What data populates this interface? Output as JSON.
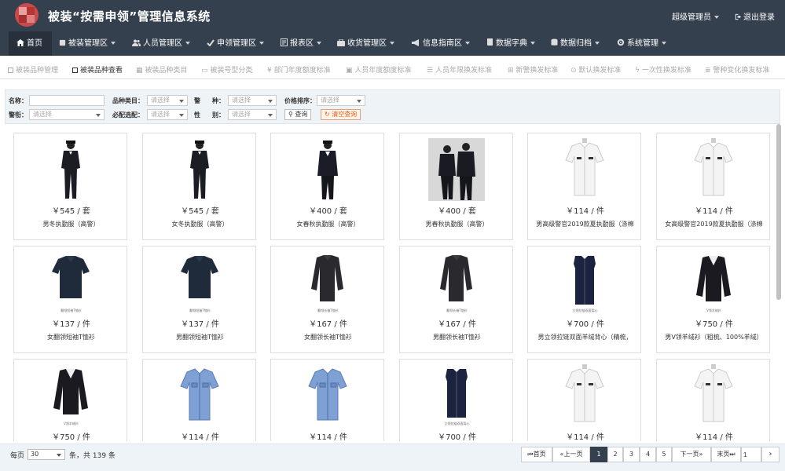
{
  "app": {
    "title": "被装“按需申领”管理信息系统"
  },
  "header": {
    "user": "超级管理员",
    "logout": "退出登录"
  },
  "nav": [
    {
      "label": "首页",
      "icon": "home-icon"
    },
    {
      "label": "被装管理区",
      "icon": "square-icon"
    },
    {
      "label": "人员管理区",
      "icon": "users-icon"
    },
    {
      "label": "申领管理区",
      "icon": "check-icon"
    },
    {
      "label": "报表区",
      "icon": "report-icon"
    },
    {
      "label": "收货管理区",
      "icon": "briefcase-icon"
    },
    {
      "label": "信息指南区",
      "icon": "megaphone-icon"
    },
    {
      "label": "数据字典",
      "icon": "book-icon"
    },
    {
      "label": "数据归档",
      "icon": "database-icon"
    },
    {
      "label": "系统管理",
      "icon": "gear-icon"
    }
  ],
  "subtabs": [
    {
      "label": "被装品种管理"
    },
    {
      "label": "被装品种查看"
    },
    {
      "label": "被装品种类目"
    },
    {
      "label": "被装号型分类"
    },
    {
      "label": "部门年度额度标准"
    },
    {
      "label": "人员年度额度标准"
    },
    {
      "label": "人员年限换发标准"
    },
    {
      "label": "新警换发标准"
    },
    {
      "label": "默认换发标准"
    },
    {
      "label": "一次性换发标准"
    },
    {
      "label": "警种变化换发标准"
    }
  ],
  "filters": {
    "name_label": "名称：",
    "name_value": "",
    "category_label": "品种类目：",
    "category_placeholder": "请选择",
    "police_type_label_a": "警",
    "police_type_label_b": "种：",
    "police_type_placeholder": "请选择",
    "price_sort_label": "价格排序：",
    "price_sort_placeholder": "请选择",
    "rank_label": "警衔：",
    "rank_placeholder": "请选择",
    "required_label": "必配选配：",
    "required_placeholder": "请选择",
    "gender_label_a": "性",
    "gender_label_b": "别：",
    "gender_placeholder": "请选择",
    "search_btn": "查询",
    "clear_btn": "清空查询"
  },
  "products": [
    {
      "price": "￥545 / 套",
      "name": "男冬执勤服（高警）",
      "kind": "winter"
    },
    {
      "price": "￥545 / 套",
      "name": "女冬执勤服（高警）",
      "kind": "winter"
    },
    {
      "price": "￥400 / 套",
      "name": "女春秋执勤服（高警）",
      "kind": "spring"
    },
    {
      "price": "￥400 / 套",
      "name": "男春秋执勤服（高警）",
      "kind": "pair"
    },
    {
      "price": "￥114 / 件",
      "name": "男高级警官2019款夏执勤服（涤棉",
      "kind": "whiteshirt"
    },
    {
      "price": "￥114 / 件",
      "name": "女高级警官2019款夏执勤服（涤棉",
      "kind": "whiteshirt"
    },
    {
      "price": "￥137 / 件",
      "name": "女翻领短袖T恤衫",
      "kind": "darkshort",
      "caption": "翻领短袖T恤衫"
    },
    {
      "price": "￥137 / 件",
      "name": "男翻领短袖T恤衫",
      "kind": "darkshort",
      "caption": "翻领短袖T恤衫"
    },
    {
      "price": "￥167 / 件",
      "name": "女翻领长袖T恤衫",
      "kind": "darklong",
      "caption": "翻领长袖T恤衫"
    },
    {
      "price": "￥167 / 件",
      "name": "男翻领长袖T恤衫",
      "kind": "darklong",
      "caption": "翻领长袖T恤衫"
    },
    {
      "price": "￥700 / 件",
      "name": "男立领拉链双面羊绒背心（精梳，",
      "kind": "vest",
      "caption": "立领拉链双面背心"
    },
    {
      "price": "￥750 / 件",
      "name": "男V领羊绒衫（粗梳、100%羊绒）",
      "kind": "sweater",
      "caption": "V领羊绒衫"
    },
    {
      "price": "￥750 / 件",
      "name": "",
      "kind": "sweater",
      "caption": "V领羊绒衫"
    },
    {
      "price": "￥114 / 件",
      "name": "",
      "kind": "blueshirt"
    },
    {
      "price": "￥114 / 件",
      "name": "",
      "kind": "blueshirt"
    },
    {
      "price": "￥700 / 件",
      "name": "",
      "kind": "vest",
      "caption": "立领拉链双面背心"
    },
    {
      "price": "￥114 / 件",
      "name": "",
      "kind": "whiteshirt"
    },
    {
      "price": "￥114 / 件",
      "name": "",
      "kind": "whiteshirt"
    }
  ],
  "footer": {
    "per_page_label": "每页",
    "per_page_value": "30",
    "total_text": "条，共 139 条",
    "first": "首页",
    "prev": "上一页",
    "pages": [
      "1",
      "2",
      "3",
      "4",
      "5"
    ],
    "current_page": "1",
    "next": "下一页",
    "last": "末页",
    "jump_value": "1"
  },
  "colors": {
    "header_bg": "#35404f",
    "active_nav": "#28303c",
    "clear_btn": "#e06020"
  }
}
